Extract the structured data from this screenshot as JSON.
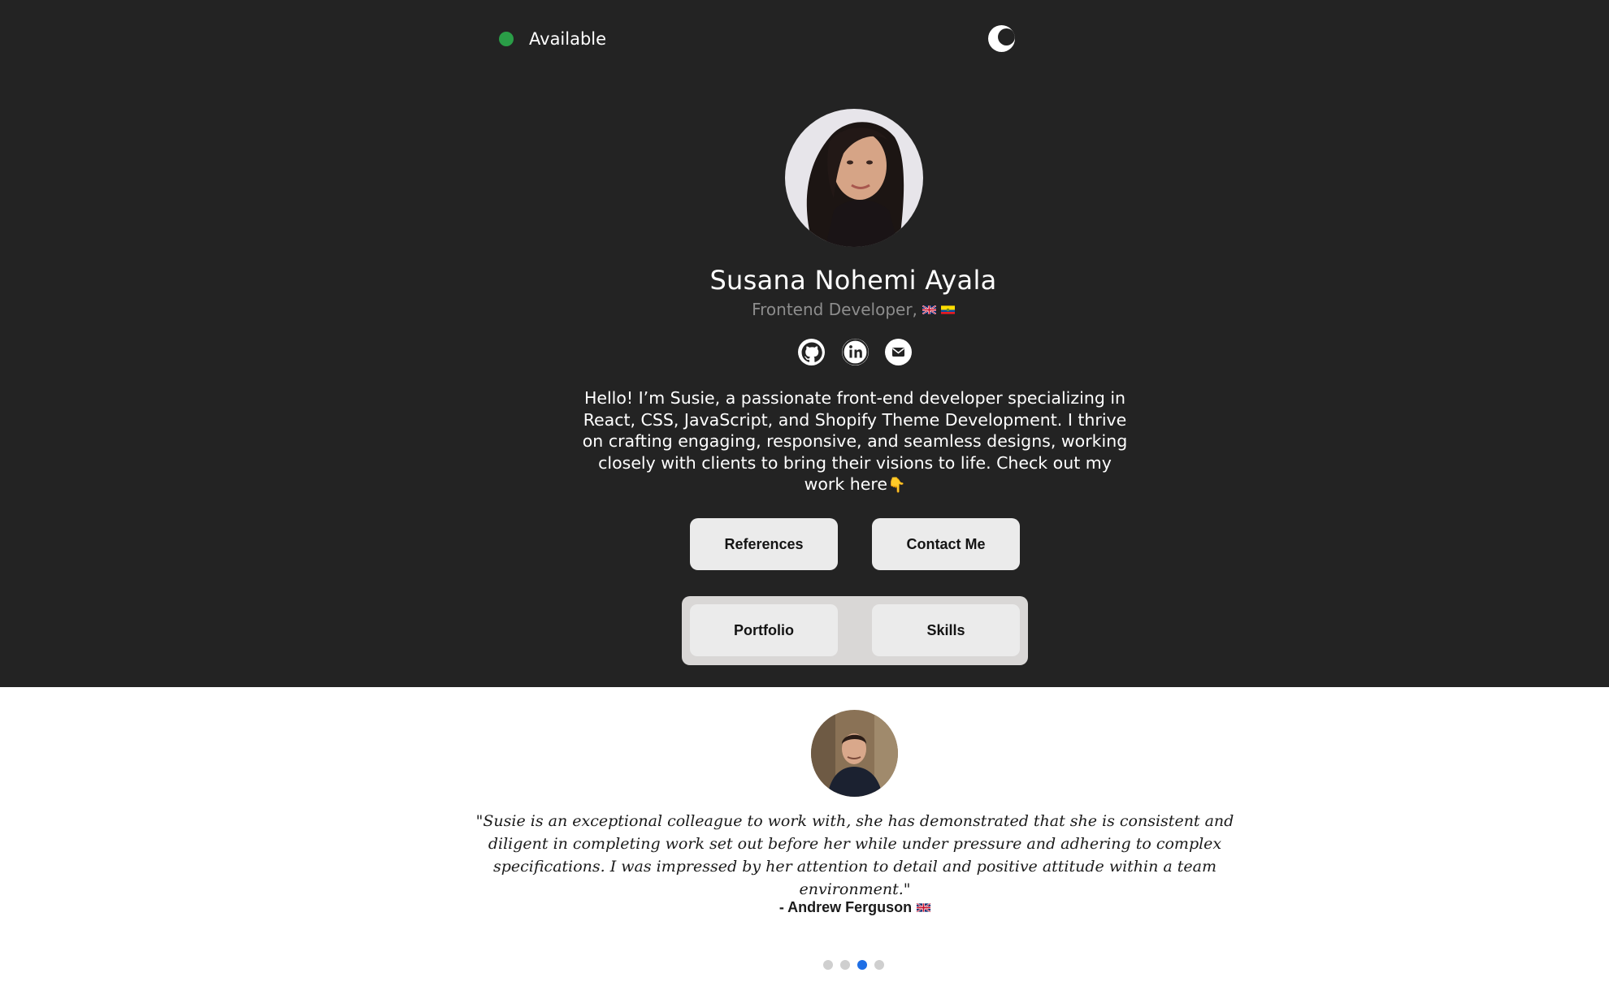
{
  "status": {
    "label": "Available",
    "color": "#2a9d47",
    "icon": "status-dot"
  },
  "theme_toggle": {
    "icon": "moon-icon"
  },
  "profile": {
    "name": "Susana Nohemi Ayala",
    "role": "Frontend Developer,",
    "flags": [
      "uk-flag-icon",
      "ecuador-flag-icon"
    ],
    "socials": [
      {
        "name": "github",
        "icon": "github-icon"
      },
      {
        "name": "linkedin",
        "icon": "linkedin-icon"
      },
      {
        "name": "email",
        "icon": "mail-icon"
      }
    ],
    "bio": "Hello! I’m Susie, a passionate front-end developer specializing in React, CSS, JavaScript, and Shopify Theme Development. I thrive on crafting engaging, responsive, and seamless designs, working closely with clients to bring their visions to life. Check out my work here",
    "bio_emoji": "👇"
  },
  "actions": {
    "references_label": "References",
    "contact_label": "Contact Me"
  },
  "tabs": [
    {
      "label": "Portfolio"
    },
    {
      "label": "Skills"
    }
  ],
  "testimonial": {
    "quote": "\"Susie is an exceptional colleague to work with, she has demonstrated that she is consistent and diligent in completing work set out before her while under pressure and adhering to complex specifications. I was impressed by her attention to detail and positive attitude within a team environment.\"",
    "author": "- Andrew Ferguson",
    "author_flag": "uk-flag-icon"
  },
  "carousel": {
    "count": 4,
    "active_index": 2,
    "active_color": "#1f6fe5"
  },
  "colors": {
    "hero_bg": "#232323",
    "page_bg": "#ffffff",
    "button_bg": "#ebebeb",
    "muted_text": "#8d8d8d"
  }
}
